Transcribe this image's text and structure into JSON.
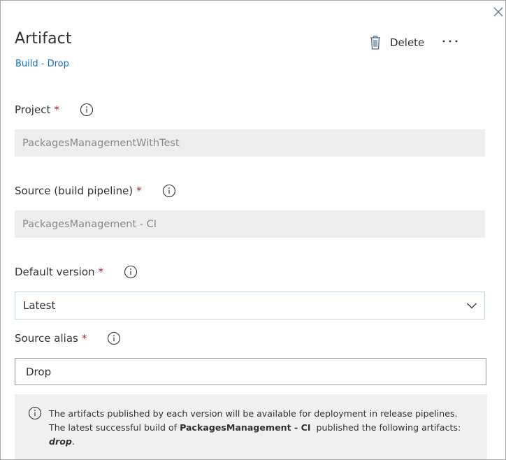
{
  "panel": {
    "title": "Artifact",
    "subtitle": "Build - Drop",
    "delete_label": "Delete",
    "more_label": "···"
  },
  "fields": {
    "project": {
      "label": "Project",
      "required_marker": "*",
      "value": "PackagesManagementWithTest"
    },
    "source": {
      "label": "Source (build pipeline)",
      "required_marker": "*",
      "value": "PackagesManagement - CI"
    },
    "default_version": {
      "label": "Default version",
      "required_marker": "*",
      "selected": "Latest"
    },
    "source_alias": {
      "label": "Source alias",
      "required_marker": "*",
      "value": "Drop"
    }
  },
  "info": {
    "line1": "The artifacts published by each version will be available for deployment in release pipelines.",
    "line2_prefix": "The latest successful build of ",
    "line2_bold": "PackagesManagement - CI",
    "line2_suffix": "  published the following artifacts:",
    "artifact_name": "drop",
    "period": "."
  },
  "icons": {
    "close": "close-icon",
    "delete": "trash-icon",
    "more": "more-ellipsis-icon",
    "info": "info-icon",
    "dropdown": "chevron-down-icon"
  },
  "colors": {
    "link": "#106ebe",
    "required": "#a4262c",
    "readonly_bg": "#eeeeee",
    "info_bg": "#f0f0f0",
    "icon": "#4a6a8a"
  }
}
